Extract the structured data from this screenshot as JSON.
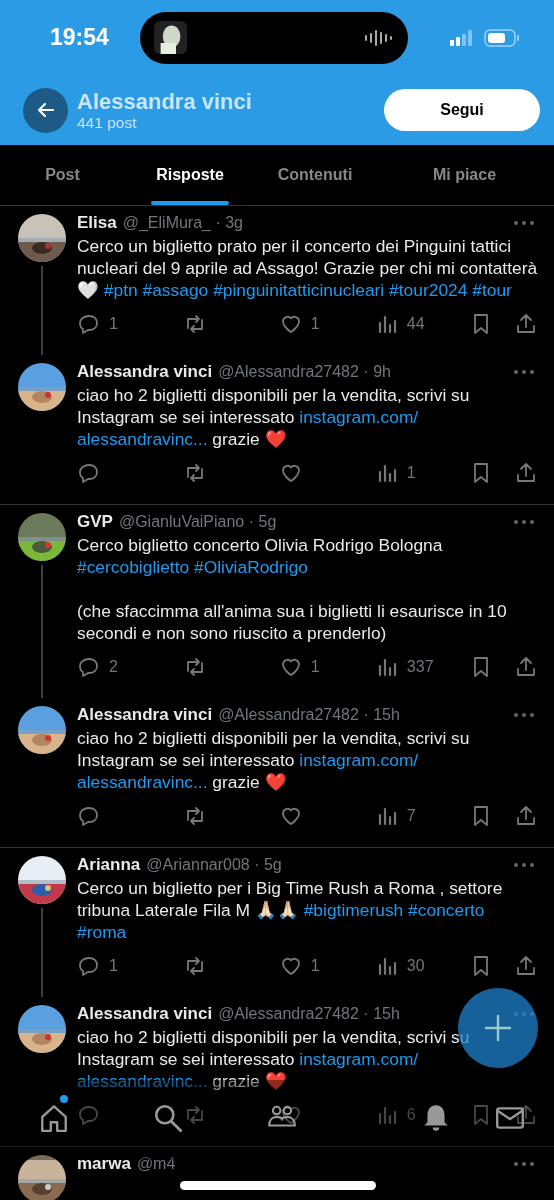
{
  "status_bar": {
    "time": "19:54"
  },
  "header": {
    "title": "Alessandra vinci",
    "subtitle": "441 post",
    "follow_button": "Segui"
  },
  "tabs": [
    {
      "label": "Post",
      "selected": false
    },
    {
      "label": "Risposte",
      "selected": true
    },
    {
      "label": "Contenuti",
      "selected": false
    },
    {
      "label": "Mi piace",
      "selected": false
    }
  ],
  "threads": [
    {
      "posts": [
        {
          "name": "Elisa",
          "meta": "@_EliMura_ · 3g",
          "body": [
            [
              {
                "kind": "text",
                "text": "Cerco un biglietto prato per il concerto dei Pinguini tattici nucleari del 9 aprile ad Assago! Grazie per chi mi contatterà 🤍 "
              },
              {
                "kind": "hashtag",
                "text": "#ptn "
              },
              {
                "kind": "hashtag",
                "text": "#assago "
              },
              {
                "kind": "hashtag",
                "text": "#pinguinitatticinucleari "
              },
              {
                "kind": "hashtag",
                "text": "#tour2024 "
              },
              {
                "kind": "hashtag",
                "text": "#tour"
              }
            ]
          ],
          "replies": "1",
          "likes": "1",
          "views": "44"
        },
        {
          "name": "Alessandra vinci",
          "meta": "@Alessandra27482 · 9h",
          "body": [
            [
              {
                "kind": "text",
                "text": "ciao ho 2 biglietti disponibili per la vendita, scrivi su Instagram se sei interessato "
              },
              {
                "kind": "link",
                "text": "instagram.com/"
              },
              {
                "kind": "link",
                "text": "alessandravinc..."
              },
              {
                "kind": "text",
                "text": " grazie ❤️"
              }
            ]
          ],
          "views": "1"
        }
      ]
    },
    {
      "posts": [
        {
          "name": "GVP",
          "meta": "@GianluVaiPiano · 5g",
          "body": [
            [
              {
                "kind": "text",
                "text": "Cerco biglietto concerto Olivia Rodrigo Bologna "
              },
              {
                "kind": "hashtag",
                "text": "#cercobiglietto "
              },
              {
                "kind": "hashtag",
                "text": "#OliviaRodrigo"
              }
            ],
            [
              {
                "kind": "text",
                "text": "(che sfaccimma all'anima sua i biglietti li esaurisce in 10 secondi e non sono riuscito a prenderlo)"
              }
            ]
          ],
          "replies": "2",
          "likes": "1",
          "views": "337"
        },
        {
          "name": "Alessandra vinci",
          "meta": "@Alessandra27482 · 15h",
          "body": [
            [
              {
                "kind": "text",
                "text": "ciao ho 2 biglietti disponibili per la vendita, scrivi su Instagram se sei interessato "
              },
              {
                "kind": "link",
                "text": "instagram.com/"
              },
              {
                "kind": "link",
                "text": "alessandravinc..."
              },
              {
                "kind": "text",
                "text": " grazie ❤️"
              }
            ]
          ],
          "views": "7"
        }
      ]
    },
    {
      "posts": [
        {
          "name": "Arianna",
          "meta": "@Ariannar008 · 5g",
          "body": [
            [
              {
                "kind": "text",
                "text": "Cerco un biglietto per i Big Time Rush a Roma , settore tribuna Laterale Fila M 🙏🏻🙏🏻 "
              },
              {
                "kind": "hashtag",
                "text": "#bigtimerush "
              },
              {
                "kind": "hashtag",
                "text": "#concerto "
              },
              {
                "kind": "hashtag",
                "text": "#roma"
              }
            ]
          ],
          "replies": "1",
          "likes": "1",
          "views": "30"
        },
        {
          "name": "Alessandra vinci",
          "meta": "@Alessandra27482 · 15h",
          "body": [
            [
              {
                "kind": "text",
                "text": "ciao ho 2 biglietti disponibili per la vendita, scrivi su Instagram se sei interessato "
              },
              {
                "kind": "link",
                "text": "instagram.com/"
              },
              {
                "kind": "link",
                "text": "alessandravinc..."
              },
              {
                "kind": "text",
                "text": " grazie ❤️"
              }
            ]
          ],
          "views": "6"
        }
      ]
    },
    {
      "posts": [
        {
          "name": "marwa",
          "meta": "@m4"
        }
      ]
    }
  ],
  "bottom_nav": [
    {
      "kind": "home",
      "badge": true
    },
    {
      "kind": "search"
    },
    {
      "kind": "communities"
    },
    {
      "kind": "notifications"
    },
    {
      "kind": "messages"
    }
  ]
}
